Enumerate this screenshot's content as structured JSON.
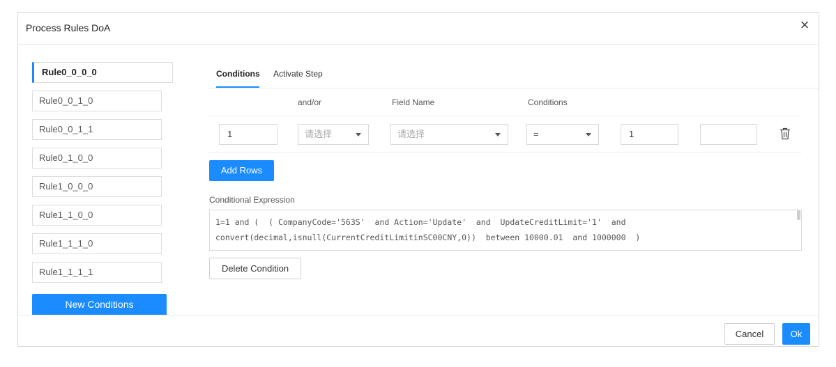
{
  "dialog": {
    "title": "Process Rules DoA",
    "close_label": "×"
  },
  "sidebar": {
    "rules": [
      {
        "label": "Rule0_0_0_0",
        "active": true
      },
      {
        "label": "Rule0_0_1_0",
        "active": false
      },
      {
        "label": "Rule0_0_1_1",
        "active": false
      },
      {
        "label": "Rule0_1_0_0",
        "active": false
      },
      {
        "label": "Rule1_0_0_0",
        "active": false
      },
      {
        "label": "Rule1_1_0_0",
        "active": false
      },
      {
        "label": "Rule1_1_1_0",
        "active": false
      },
      {
        "label": "Rule1_1_1_1",
        "active": false
      }
    ],
    "new_conditions_label": "New Conditions"
  },
  "tabs": [
    {
      "label": "Conditions",
      "active": true
    },
    {
      "label": "Activate Step",
      "active": false
    }
  ],
  "table": {
    "headers": {
      "and_or": "and/or",
      "field_name": "Field Name",
      "conditions": "Conditions"
    },
    "row": {
      "index_value": "1",
      "and_or_placeholder": "请选择",
      "field_name_placeholder": "请选择",
      "operator_value": "=",
      "value1": "1",
      "value2": ""
    }
  },
  "add_rows_label": "Add Rows",
  "expression": {
    "label": "Conditional Expression",
    "line1": "1=1 and (  ( CompanyCode='563S'  and Action='Update'  and  UpdateCreditLimit='1'  and",
    "line2": "convert(decimal,isnull(CurrentCreditLimitinSC00CNY,0))  between 10000.01  and 1000000  )"
  },
  "delete_condition_label": "Delete Condition",
  "footer": {
    "cancel_label": "Cancel",
    "ok_label": "Ok"
  },
  "colors": {
    "accent": "#1a8cff"
  }
}
